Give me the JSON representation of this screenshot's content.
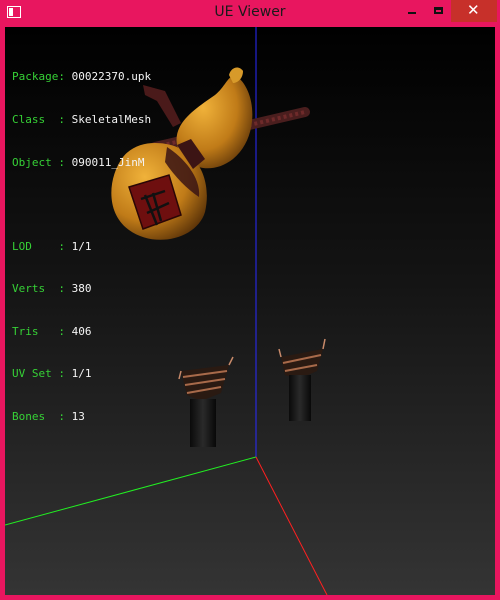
{
  "window": {
    "title": "UE Viewer"
  },
  "info": {
    "group1": [
      {
        "label": "Package: ",
        "value": "00022370.upk"
      },
      {
        "label": "Class  : ",
        "value": "SkeletalMesh"
      },
      {
        "label": "Object : ",
        "value": "090011_JinM"
      }
    ],
    "group2": [
      {
        "label": "LOD    : ",
        "value": "1/1"
      },
      {
        "label": "Verts  : ",
        "value": "380"
      },
      {
        "label": "Tris   : ",
        "value": "406"
      },
      {
        "label": "UV Set : ",
        "value": "1/1"
      },
      {
        "label": "Bones  : ",
        "value": "13"
      }
    ]
  },
  "colors": {
    "window_frame": "#e8165f",
    "close_button": "#c7302a",
    "info_label": "#36d136",
    "axis_x": "#ff2020",
    "axis_y": "#22ee22",
    "axis_z": "#2a2aff"
  }
}
